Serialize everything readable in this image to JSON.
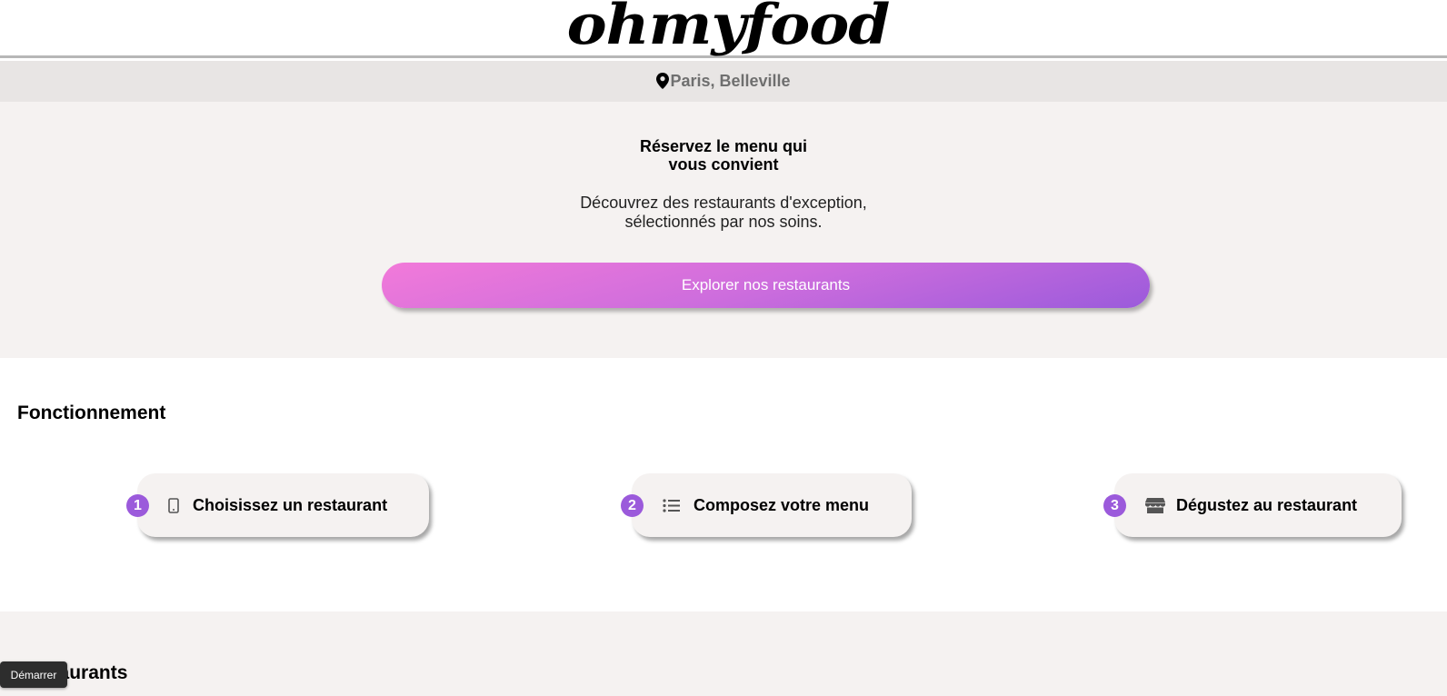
{
  "header": {
    "logo_text": "ohmyfood"
  },
  "location": {
    "icon": "map-pin-icon",
    "text": "Paris, Belleville"
  },
  "hero": {
    "title_line1": "Réservez le menu qui",
    "title_line2": "vous convient",
    "subtitle_line1": "Découvrez des restaurants d'exception,",
    "subtitle_line2": "sélectionnés par nos soins.",
    "cta_label": "Explorer nos restaurants",
    "cta_gradient": [
      "#f27ad9",
      "#9b5adb"
    ]
  },
  "how_it_works": {
    "title": "Fonctionnement",
    "steps": [
      {
        "number": "1",
        "icon": "mobile-phone-icon",
        "label": "Choisissez un restaurant"
      },
      {
        "number": "2",
        "icon": "list-icon",
        "label": "Composez votre menu"
      },
      {
        "number": "3",
        "icon": "store-icon",
        "label": "Dégustez au restaurant"
      }
    ],
    "badge_color": "#9b5adb"
  },
  "restaurants": {
    "title": "Restaurants"
  },
  "overlay": {
    "start_button_label": "Démarrer"
  }
}
